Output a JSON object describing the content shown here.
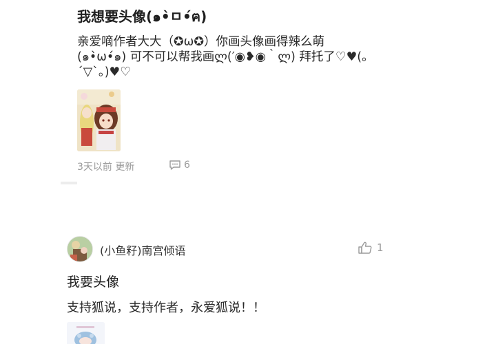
{
  "post1": {
    "title": "我想要头像(๑•̀ㅁ•́ฅ)",
    "body_lines": [
      "亲爱嘀作者大大（✪ω✪）你画头像画得辣么萌",
      "(๑•̀ω•́๑)   可不可以帮我画ლ(′◉❥◉｀ლ)     拜托了♡♥(｡",
      "´▽`｡)♥♡"
    ],
    "time": "3天以前 更新",
    "comments": "6",
    "icons": {
      "comment": "comment-bubble-icon"
    }
  },
  "post2": {
    "author": "(小鱼籽)南宫倾语",
    "likes": "1",
    "title": "我要头像",
    "body": "支持狐说，支持作者，永爱狐说！！",
    "icons": {
      "like": "thumbs-up-icon"
    }
  },
  "colors": {
    "text": "#222222",
    "muted": "#9a9a9a",
    "background": "#ffffff"
  }
}
